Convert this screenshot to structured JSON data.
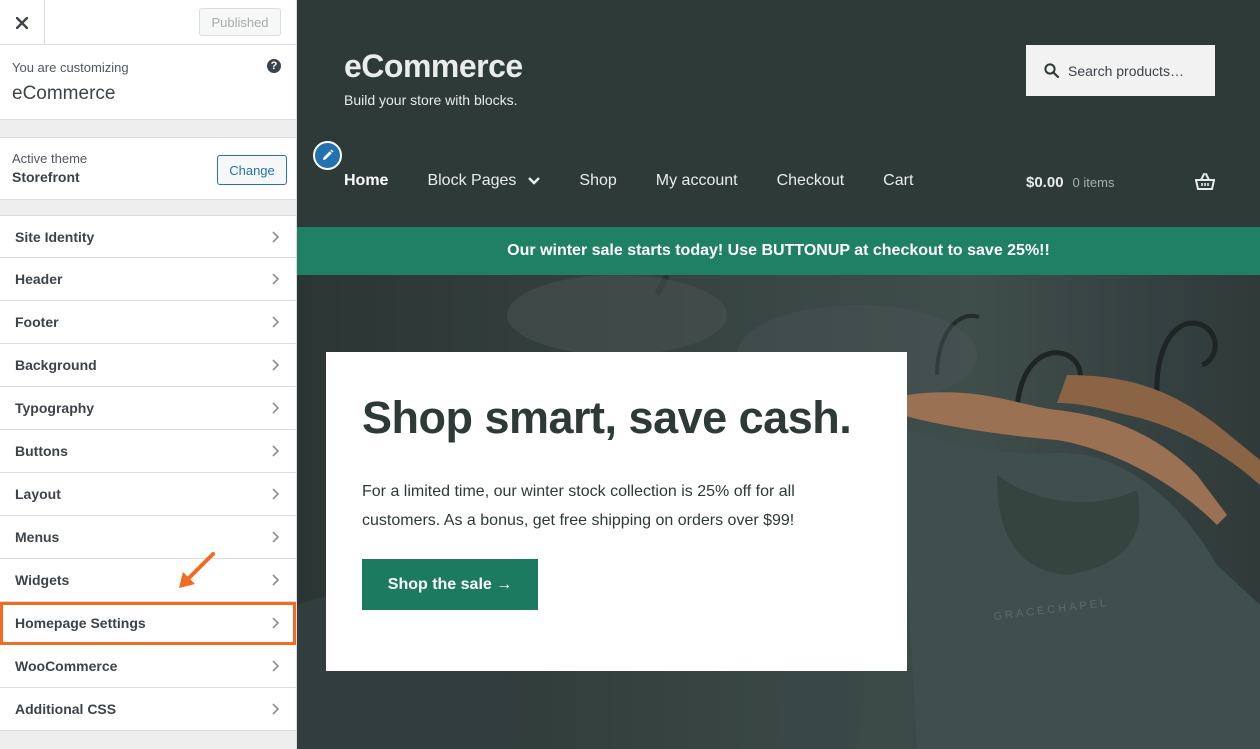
{
  "customizer": {
    "close_label": "✕",
    "published_label": "Published",
    "customizing_label": "You are customizing",
    "site_name": "eCommerce",
    "help_icon": "?",
    "active_theme_label": "Active theme",
    "active_theme_name": "Storefront",
    "change_label": "Change",
    "sections": [
      {
        "label": "Site Identity"
      },
      {
        "label": "Header"
      },
      {
        "label": "Footer"
      },
      {
        "label": "Background"
      },
      {
        "label": "Typography"
      },
      {
        "label": "Buttons"
      },
      {
        "label": "Layout"
      },
      {
        "label": "Menus"
      },
      {
        "label": "Widgets"
      },
      {
        "label": "Homepage Settings",
        "highlighted": true
      },
      {
        "label": "WooCommerce"
      },
      {
        "label": "Additional CSS"
      }
    ],
    "annotation_color": "#f26b21"
  },
  "site": {
    "title": "eCommerce",
    "tagline": "Build your store with blocks.",
    "search_placeholder": "Search products…",
    "nav": [
      {
        "label": "Home",
        "active": true
      },
      {
        "label": "Block Pages",
        "has_submenu": true
      },
      {
        "label": "Shop"
      },
      {
        "label": "My account"
      },
      {
        "label": "Checkout"
      },
      {
        "label": "Cart"
      }
    ],
    "cart_total": "$0.00",
    "cart_items": "0 items",
    "banner": "Our winter sale starts today! Use BUTTONUP at checkout to save 25%!!",
    "hero": {
      "title": "Shop smart, save cash.",
      "text": "For a limited time, our winter stock collection is 25% off for all customers. As a bonus, get free shipping on orders over $99!",
      "cta": "Shop the sale →",
      "shirt_print": "GRACECHAPEL"
    },
    "colors": {
      "header_bg": "#2d3a38",
      "banner_bg": "#1f8064",
      "cta_bg": "#1b7a60",
      "customizer_accent": "#2271b1"
    }
  }
}
